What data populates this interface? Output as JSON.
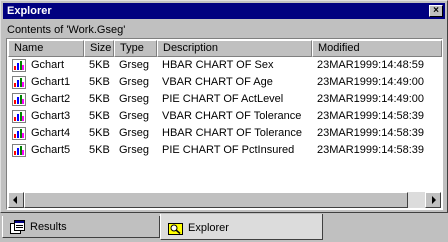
{
  "window": {
    "title": "Explorer",
    "close_glyph": "×"
  },
  "contents_label": "Contents of 'Work.Gseg'",
  "columns": [
    "Name",
    "Size",
    "Type",
    "Description",
    "Modified"
  ],
  "rows": [
    {
      "name": "Gchart",
      "size": "5KB",
      "type": "Grseg",
      "description": "HBAR CHART OF Sex",
      "modified": "23MAR1999:14:48:59",
      "icon": "chart-file-icon"
    },
    {
      "name": "Gchart1",
      "size": "5KB",
      "type": "Grseg",
      "description": "VBAR CHART OF Age",
      "modified": "23MAR1999:14:49:00",
      "icon": "chart-file-icon"
    },
    {
      "name": "Gchart2",
      "size": "5KB",
      "type": "Grseg",
      "description": "PIE CHART OF ActLevel",
      "modified": "23MAR1999:14:49:00",
      "icon": "chart-file-icon"
    },
    {
      "name": "Gchart3",
      "size": "5KB",
      "type": "Grseg",
      "description": "VBAR CHART OF Tolerance",
      "modified": "23MAR1999:14:58:39",
      "icon": "chart-file-icon"
    },
    {
      "name": "Gchart4",
      "size": "5KB",
      "type": "Grseg",
      "description": "HBAR CHART OF Tolerance",
      "modified": "23MAR1999:14:58:39",
      "icon": "chart-file-icon"
    },
    {
      "name": "Gchart5",
      "size": "5KB",
      "type": "Grseg",
      "description": "PIE CHART OF PctInsured",
      "modified": "23MAR1999:14:58:39",
      "icon": "chart-file-icon"
    }
  ],
  "tabs": [
    {
      "label": "Results",
      "icon": "results-icon",
      "active": false
    },
    {
      "label": "Explorer",
      "icon": "explorer-icon",
      "active": true
    }
  ],
  "colors": {
    "titlebar": "#000080",
    "face": "#c0c0c0",
    "list_bg": "#ffffff"
  }
}
